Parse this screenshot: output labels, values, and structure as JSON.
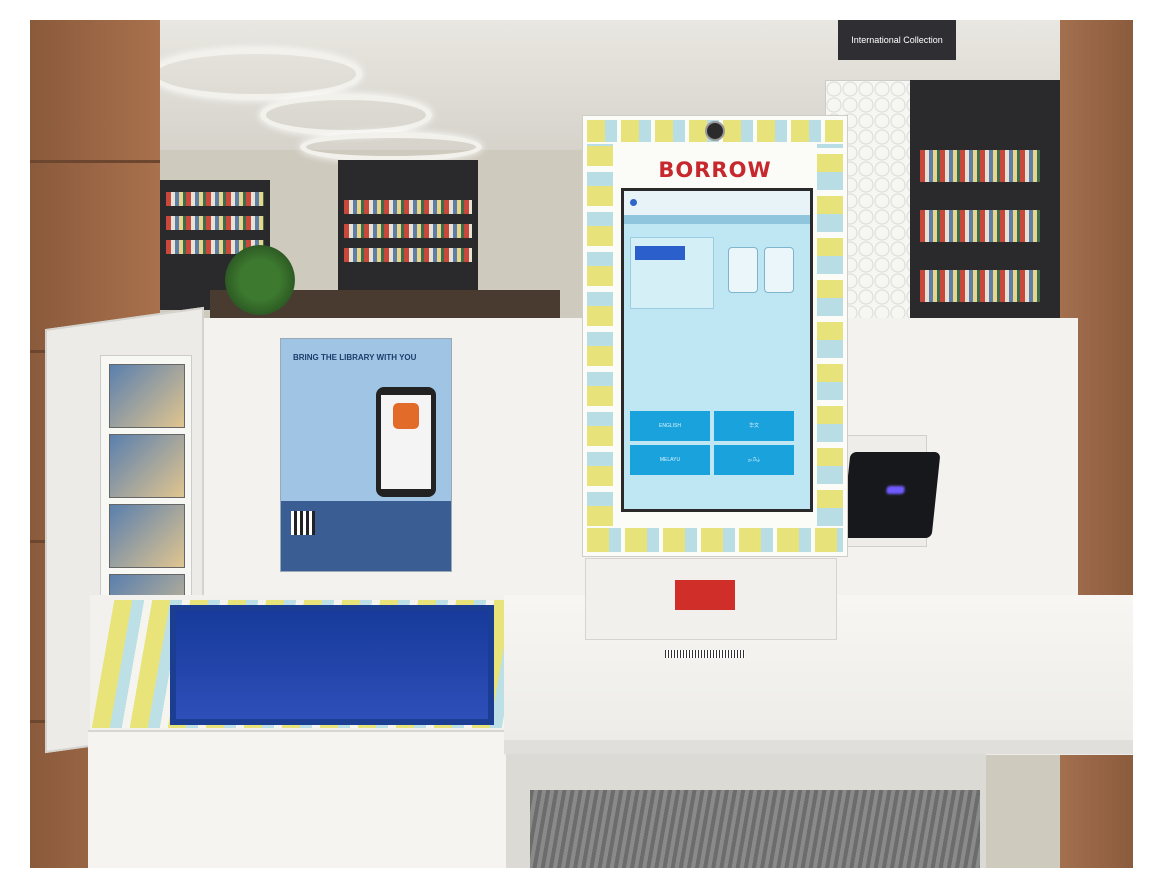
{
  "photo": {
    "description_colors": {
      "brand_red": "#c7282d",
      "screen_blue": "#19a2dc",
      "bin_blue": "#1b3d92",
      "tile_yellow": "#e7e27a",
      "tile_cyan": "#b9dde5"
    }
  },
  "signage": {
    "section_sign": "International Collection"
  },
  "kiosk": {
    "title": "BORROW",
    "screen": {
      "top_bar": "",
      "heading": "",
      "greeting": "",
      "body_text": "",
      "language_buttons": [
        "ENGLISH",
        "华文",
        "MELAYU",
        "தமிழ்"
      ]
    }
  },
  "poster": {
    "title": "BRING THE LIBRARY WITH YOU"
  },
  "icons": [
    "camera-icon",
    "scanner-icon",
    "rfid-pad-icon",
    "qr-code-icon",
    "app-icon"
  ]
}
